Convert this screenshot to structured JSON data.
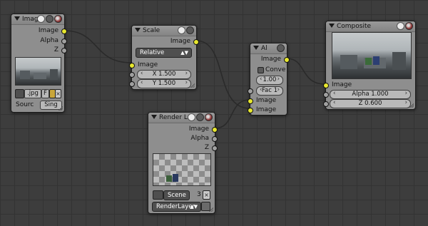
{
  "nodes": {
    "image": {
      "title": "Image",
      "outputs": [
        "Image",
        "Alpha",
        "Z"
      ],
      "filename": ".jpg",
      "flag": "F",
      "source_label": "Sourc",
      "source_value": "Sing"
    },
    "scale": {
      "title": "Scale",
      "output": "Image",
      "space": "Relative",
      "input": "Image",
      "x": "X 1.500",
      "y": "Y 1.500"
    },
    "alpha_over": {
      "title": "Al",
      "output": "Image",
      "convert_label": "Conve",
      "premul": "1.00",
      "fac": "Fac 1",
      "input1": "Image",
      "input2": "Image"
    },
    "composite": {
      "title": "Composite",
      "input": "Image",
      "alpha": "Alpha 1.000",
      "z": "Z 0.600"
    },
    "render_layers": {
      "title": "Render Lay",
      "outputs": [
        "Image",
        "Alpha",
        "Z"
      ],
      "scene": "Scene",
      "scene_users": "3",
      "layer": "RenderLayer"
    }
  },
  "colors": {
    "background": "#3d3d3d",
    "node_body": "#8e8e8e",
    "socket_color": "#e7e72f",
    "socket_value": "#a0a0a0"
  }
}
